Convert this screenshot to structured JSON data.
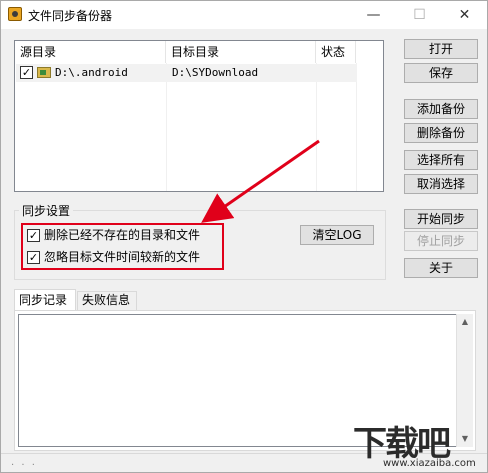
{
  "window": {
    "title": "文件同步备份器",
    "minimize": "—",
    "maximize": "☐",
    "close": "✕"
  },
  "list": {
    "columns": [
      "源目录",
      "目标目录",
      "状态"
    ],
    "rows": [
      {
        "checked": "✓",
        "source": "D:\\.android",
        "target": "D:\\SYDownload",
        "status": ""
      }
    ]
  },
  "buttons": {
    "open": "打开",
    "save": "保存",
    "add": "添加备份",
    "delete": "删除备份",
    "select_all": "选择所有",
    "deselect": "取消选择",
    "start_sync": "开始同步",
    "stop_sync": "停止同步",
    "about": "关于",
    "clear_log": "清空LOG"
  },
  "sync_settings": {
    "title": "同步设置",
    "options": [
      {
        "checked": "✓",
        "label": "删除已经不存在的目录和文件"
      },
      {
        "checked": "✓",
        "label": "忽略目标文件时间较新的文件"
      }
    ]
  },
  "tabs": [
    "同步记录",
    "失败信息"
  ],
  "log": {
    "scroll_up": "▲",
    "scroll_down": "▼"
  },
  "status": {
    "text": ". . ."
  },
  "watermark": {
    "big": "下载吧",
    "small": "www.xiazaiba.com"
  },
  "colors": {
    "highlight": "#e0001a",
    "arrow": "#e0001a"
  }
}
